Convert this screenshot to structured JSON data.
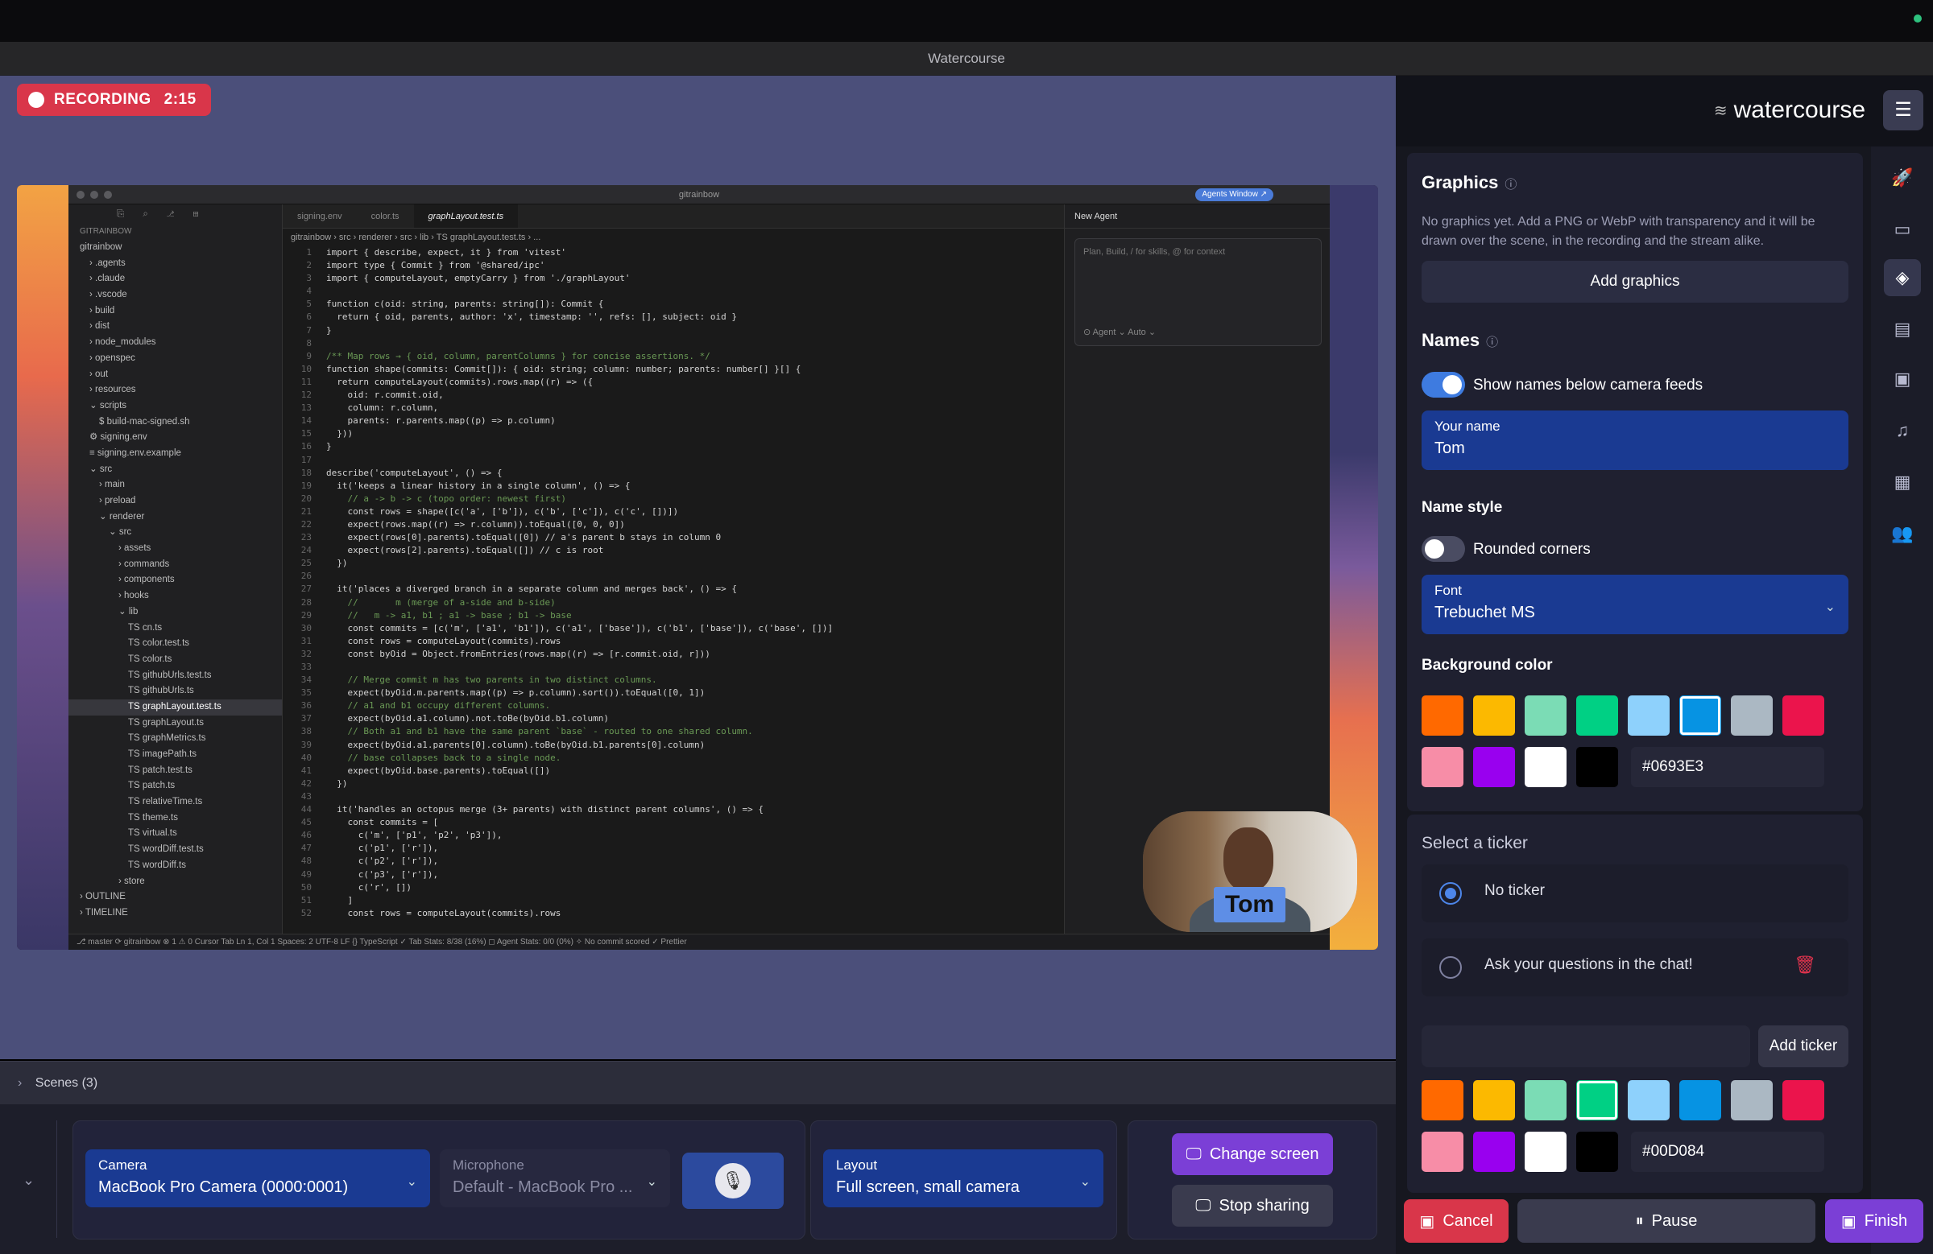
{
  "window": {
    "title": "Watercourse"
  },
  "recording": {
    "label": "RECORDING",
    "time": "2:15"
  },
  "ide": {
    "window_title": "gitrainbow",
    "agents_button": "Agents Window ↗",
    "tabs": [
      "signing.env",
      "color.ts",
      "graphLayout.test.ts"
    ],
    "breadcrumb": "gitrainbow › src › renderer › src › lib › TS graphLayout.test.ts › ...",
    "explorer_title": "GITRAINBOW",
    "tree": [
      "gitrainbow",
      "› .agents",
      "› .claude",
      "› .vscode",
      "› build",
      "› dist",
      "› node_modules",
      "› openspec",
      "› out",
      "› resources",
      "⌄ scripts",
      "$ build-mac-signed.sh",
      "⚙ signing.env",
      "≡ signing.env.example",
      "⌄ src",
      "› main",
      "› preload",
      "⌄ renderer",
      "⌄ src",
      "› assets",
      "› commands",
      "› components",
      "› hooks",
      "⌄ lib",
      "TS cn.ts",
      "TS color.test.ts",
      "TS color.ts",
      "TS githubUrls.test.ts",
      "TS githubUrls.ts",
      "TS graphLayout.test.ts",
      "TS graphLayout.ts",
      "TS graphMetrics.ts",
      "TS imagePath.ts",
      "TS patch.test.ts",
      "TS patch.ts",
      "TS relativeTime.ts",
      "TS theme.ts",
      "TS virtual.ts",
      "TS wordDiff.test.ts",
      "TS wordDiff.ts",
      "› store",
      "› OUTLINE",
      "› TIMELINE"
    ],
    "code": [
      "import { describe, expect, it } from 'vitest'",
      "import type { Commit } from '@shared/ipc'",
      "import { computeLayout, emptyCarry } from './graphLayout'",
      "",
      "function c(oid: string, parents: string[]): Commit {",
      "  return { oid, parents, author: 'x', timestamp: '', refs: [], subject: oid }",
      "}",
      "",
      "/** Map rows → { oid, column, parentColumns } for concise assertions. */",
      "function shape(commits: Commit[]): { oid: string; column: number; parents: number[] }[] {",
      "  return computeLayout(commits).rows.map((r) => ({",
      "    oid: r.commit.oid,",
      "    column: r.column,",
      "    parents: r.parents.map((p) => p.column)",
      "  }))",
      "}",
      "",
      "describe('computeLayout', () => {",
      "  it('keeps a linear history in a single column', () => {",
      "    // a -> b -> c (topo order: newest first)",
      "    const rows = shape([c('a', ['b']), c('b', ['c']), c('c', [])])",
      "    expect(rows.map((r) => r.column)).toEqual([0, 0, 0])",
      "    expect(rows[0].parents).toEqual([0]) // a's parent b stays in column 0",
      "    expect(rows[2].parents).toEqual([]) // c is root",
      "  })",
      "",
      "  it('places a diverged branch in a separate column and merges back', () => {",
      "    //       m (merge of a-side and b-side)",
      "    //   m -> a1, b1 ; a1 -> base ; b1 -> base",
      "    const commits = [c('m', ['a1', 'b1']), c('a1', ['base']), c('b1', ['base']), c('base', [])]",
      "    const rows = computeLayout(commits).rows",
      "    const byOid = Object.fromEntries(rows.map((r) => [r.commit.oid, r]))",
      "",
      "    // Merge commit m has two parents in two distinct columns.",
      "    expect(byOid.m.parents.map((p) => p.column).sort()).toEqual([0, 1])",
      "    // a1 and b1 occupy different columns.",
      "    expect(byOid.a1.column).not.toBe(byOid.b1.column)",
      "    // Both a1 and b1 have the same parent `base` - routed to one shared column.",
      "    expect(byOid.a1.parents[0].column).toBe(byOid.b1.parents[0].column)",
      "    // base collapses back to a single node.",
      "    expect(byOid.base.parents).toEqual([])",
      "  })",
      "",
      "  it('handles an octopus merge (3+ parents) with distinct parent columns', () => {",
      "    const commits = [",
      "      c('m', ['p1', 'p2', 'p3']),",
      "      c('p1', ['r']),",
      "      c('p2', ['r']),",
      "      c('p3', ['r']),",
      "      c('r', [])",
      "    ]",
      "    const rows = computeLayout(commits).rows"
    ],
    "chat_title": "New Agent",
    "chat_placeholder": "Plan, Build, / for skills, @ for context",
    "chat_tags": "⊙ Agent ⌄     Auto ⌄",
    "status": "⎇ master ⟳   gitrainbow   ⊗ 1 ⚠ 0                                                                                                                      Cursor Tab    Ln 1, Col 1    Spaces: 2    UTF-8    LF    {} TypeScript    ✓ Tab Stats: 8/38 (16%)    ◻ Agent Stats: 0/0 (0%)    ✧ No commit scored    ✓ Prettier"
  },
  "camera_overlay": {
    "name": "Tom"
  },
  "scenes": {
    "label": "Scenes (3)"
  },
  "controls": {
    "camera": {
      "label": "Camera",
      "value": "MacBook Pro Camera (0000:0001)"
    },
    "microphone": {
      "label": "Microphone",
      "value": "Default - MacBook Pro ..."
    },
    "layout": {
      "label": "Layout",
      "value": "Full screen, small camera"
    },
    "change_screen": "Change screen",
    "stop_sharing": "Stop sharing"
  },
  "panel": {
    "brand": "watercourse",
    "graphics": {
      "title": "Graphics",
      "description": "No graphics yet. Add a PNG or WebP with transparency and it will be drawn over the scene, in the recording and the stream alike.",
      "add_button": "Add graphics"
    },
    "names": {
      "title": "Names",
      "show_names_label": "Show names below camera feeds",
      "show_names": true,
      "your_name_label": "Your name",
      "your_name_value": "Tom",
      "name_style_title": "Name style",
      "rounded_label": "Rounded corners",
      "rounded": false,
      "font_label": "Font",
      "font_value": "Trebuchet MS",
      "bg_title": "Background color",
      "bg_hex": "#0693E3"
    },
    "ticker": {
      "title": "Select a ticker",
      "options": [
        "No ticker",
        "Ask your questions in the chat!"
      ],
      "selected": 0,
      "add_button": "Add ticker",
      "input_value": "",
      "hex": "#00D084"
    },
    "footer": {
      "cancel": "Cancel",
      "pause": "Pause",
      "finish": "Finish"
    }
  },
  "swatch_colors": [
    "#FF6900",
    "#FCB900",
    "#7BDCB5",
    "#00D084",
    "#8ED1FC",
    "#0693E3",
    "#ABB8C3",
    "#EB144C",
    "#F78DA7",
    "#9900EF",
    "#FFFFFF",
    "#000000"
  ],
  "icons": {
    "rail": [
      "rocket-icon",
      "video-icon",
      "layers-icon",
      "scroll-icon",
      "clapper-icon",
      "music-icon",
      "film-icon",
      "people-icon",
      "panel-collapse-icon"
    ]
  }
}
